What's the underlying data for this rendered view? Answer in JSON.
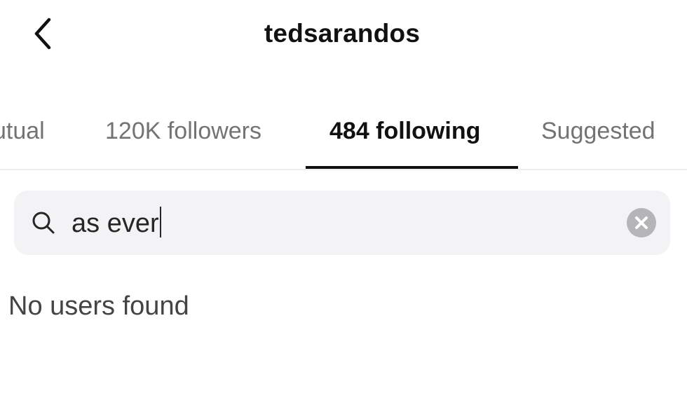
{
  "header": {
    "title": "tedsarandos",
    "back_icon": "chevron-left-icon"
  },
  "tabs": [
    {
      "label": "utual",
      "active": false
    },
    {
      "label": "120K followers",
      "active": false
    },
    {
      "label": "484 following",
      "active": true
    },
    {
      "label": "Suggested",
      "active": false
    }
  ],
  "search": {
    "value": "as ever",
    "search_icon": "search-icon",
    "clear_icon": "clear-icon"
  },
  "results": {
    "empty_message": "No users found"
  },
  "colors": {
    "background": "#ffffff",
    "active_text": "#111111",
    "inactive_text": "#737373",
    "search_background": "#f3f3f5",
    "clear_button": "#b5b5b7"
  }
}
